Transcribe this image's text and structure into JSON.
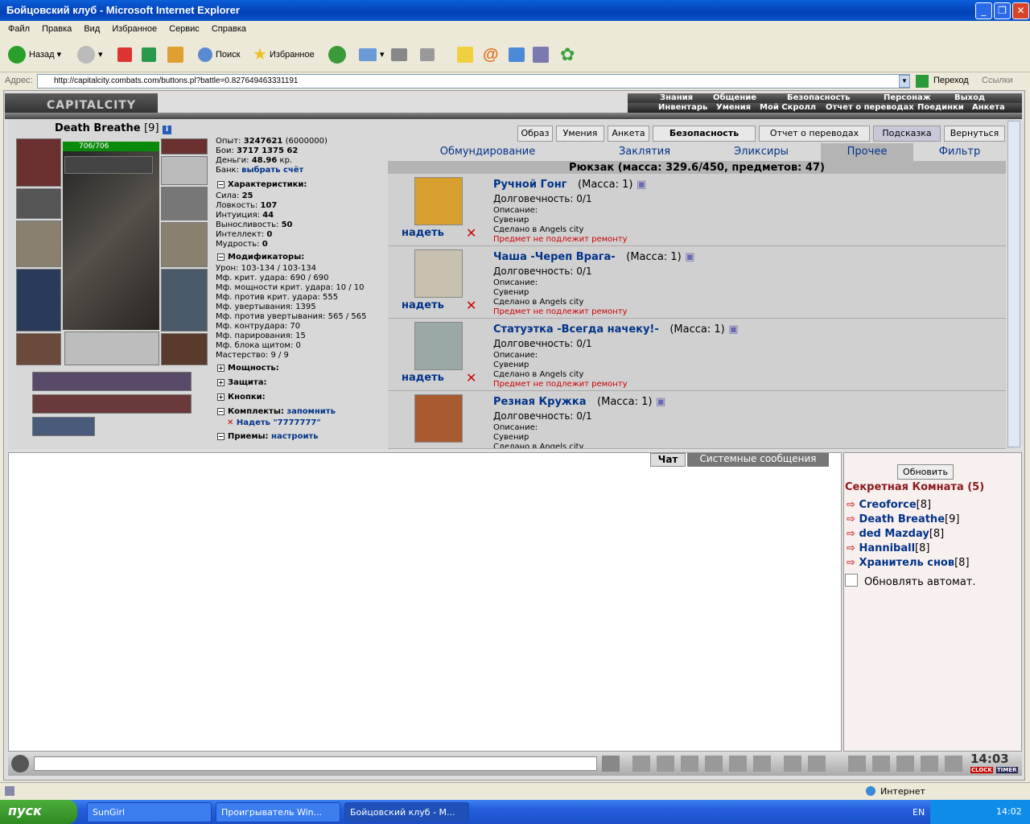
{
  "window": {
    "title": "Бойцовский клуб - Microsoft Internet Explorer"
  },
  "menu": [
    "Файл",
    "Правка",
    "Вид",
    "Избранное",
    "Сервис",
    "Справка"
  ],
  "toolbar": {
    "back": "Назад",
    "search": "Поиск",
    "favorites": "Избранное"
  },
  "address": {
    "label": "Адрес:",
    "url": "http://capitalcity.combats.com/buttons.pl?battle=0.827649463331191",
    "go": "Переход",
    "links": "Ссылки"
  },
  "site": {
    "logo": "CAPITALCITY",
    "nav1": [
      "Знания",
      "Общение",
      "Безопасность",
      "Персонаж",
      "Выход"
    ],
    "nav2": [
      "Инвентарь",
      "Умения",
      "Мой Скролл",
      "Отчет о переводах",
      "Поединки",
      "Анкета"
    ]
  },
  "character": {
    "name": "Death Breathe",
    "level": "[9]",
    "hp": "706/706",
    "stats_top": [
      {
        "label": "Опыт:",
        "value": "3247621",
        "extra": "(6000000)"
      },
      {
        "label": "Бои:",
        "value": "3717",
        "extra": "1375    62"
      },
      {
        "label": "Деньги:",
        "value": "48.96",
        "extra": "кр."
      },
      {
        "label": "Банк:",
        "value": "выбрать счёт",
        "extra": ""
      }
    ],
    "characteristics_title": "Характеристики:",
    "characteristics": [
      {
        "label": "Сила:",
        "value": "25"
      },
      {
        "label": "Ловкость:",
        "value": "107"
      },
      {
        "label": "Интуиция:",
        "value": "44"
      },
      {
        "label": "Выносливость:",
        "value": "50"
      },
      {
        "label": "Интеллект:",
        "value": "0"
      },
      {
        "label": "Мудрость:",
        "value": "0"
      }
    ],
    "modifiers_title": "Модификаторы:",
    "modifiers": [
      "Урон: 103-134 / 103-134",
      "Мф. крит. удара: 690 / 690",
      "Мф. мощности крит. удара: 10 / 10",
      "Мф. против крит. удара: 555",
      "Мф. увертывания: 1395",
      "Мф. против увертывания: 565 / 565",
      "Мф. контрудара: 70",
      "Мф. парирования: 15",
      "Мф. блока щитом: 0",
      "Мастерство: 9 / 9"
    ],
    "sections": [
      {
        "title": "Мощность:",
        "link": ""
      },
      {
        "title": "Защита:",
        "link": ""
      },
      {
        "title": "Кнопки:",
        "link": ""
      },
      {
        "title": "Комплекты:",
        "link": "запомнить"
      }
    ],
    "set_item": "Надеть \"7777777\"",
    "techniques": {
      "title": "Приемы:",
      "link": "настроить"
    }
  },
  "top_buttons": [
    "Образ",
    "Умения",
    "Анкета",
    "Безопасность",
    "Отчет о переводах",
    "Подсказка",
    "Вернуться"
  ],
  "tabs": [
    "Обмундирование",
    "Заклятия",
    "Эликсиры",
    "Прочее",
    "Фильтр"
  ],
  "backpack": {
    "header": "Рюкзак (масса: 329.6/450, предметов: 47)"
  },
  "items": [
    {
      "name": "Ручной Гонг",
      "mass": "(Масса: 1)",
      "durability": "Долговечность: 0/1",
      "desc": "Описание:",
      "type": "Сувенир",
      "made": "Сделано в Angels city",
      "repair": "Предмет не подлежит ремонту",
      "wear": "надеть"
    },
    {
      "name": "Чаша -Череп Врага-",
      "mass": "(Масса: 1)",
      "durability": "Долговечность: 0/1",
      "desc": "Описание:",
      "type": "Сувенир",
      "made": "Сделано в Angels city",
      "repair": "Предмет не подлежит ремонту",
      "wear": "надеть"
    },
    {
      "name": "Статуэтка -Всегда начеку!-",
      "mass": "(Масса: 1)",
      "durability": "Долговечность: 0/1",
      "desc": "Описание:",
      "type": "Сувенир",
      "made": "Сделано в Angels city",
      "repair": "Предмет не подлежит ремонту",
      "wear": "надеть"
    },
    {
      "name": "Резная Кружка",
      "mass": "(Масса: 1)",
      "durability": "Долговечность: 0/1",
      "desc": "Описание:",
      "type": "Сувенир",
      "made": "Сделано в Angels city",
      "repair": "",
      "wear": ""
    }
  ],
  "chat": {
    "tab_chat": "Чат",
    "tab_system": "Системные сообщения"
  },
  "online": {
    "refresh": "Обновить",
    "room": "Секретная Комната (5)",
    "users": [
      {
        "name": "Creoforce",
        "level": "[8]"
      },
      {
        "name": "Death Breathe",
        "level": "[9]"
      },
      {
        "name": "ded Mazday",
        "level": "[8]"
      },
      {
        "name": "Hanniball",
        "level": "[8]"
      },
      {
        "name": "Хранитель снов",
        "level": "[8]"
      }
    ],
    "auto_refresh": "Обновлять автомат."
  },
  "clock": {
    "time": "14:03",
    "label1": "CLOCK",
    "label2": "TIMER"
  },
  "status": {
    "zone": "Интернет"
  },
  "taskbar": {
    "start": "пуск",
    "tasks": [
      "SunGirl",
      "Проигрыватель Win...",
      "Бойцовский клуб - М..."
    ],
    "lang": "EN",
    "time": "14:02"
  },
  "colors": {
    "title_blue": "#0a5fd8",
    "link_blue": "#003388",
    "warning_red": "#cc0000",
    "hp_green": "#0a8a0a"
  }
}
